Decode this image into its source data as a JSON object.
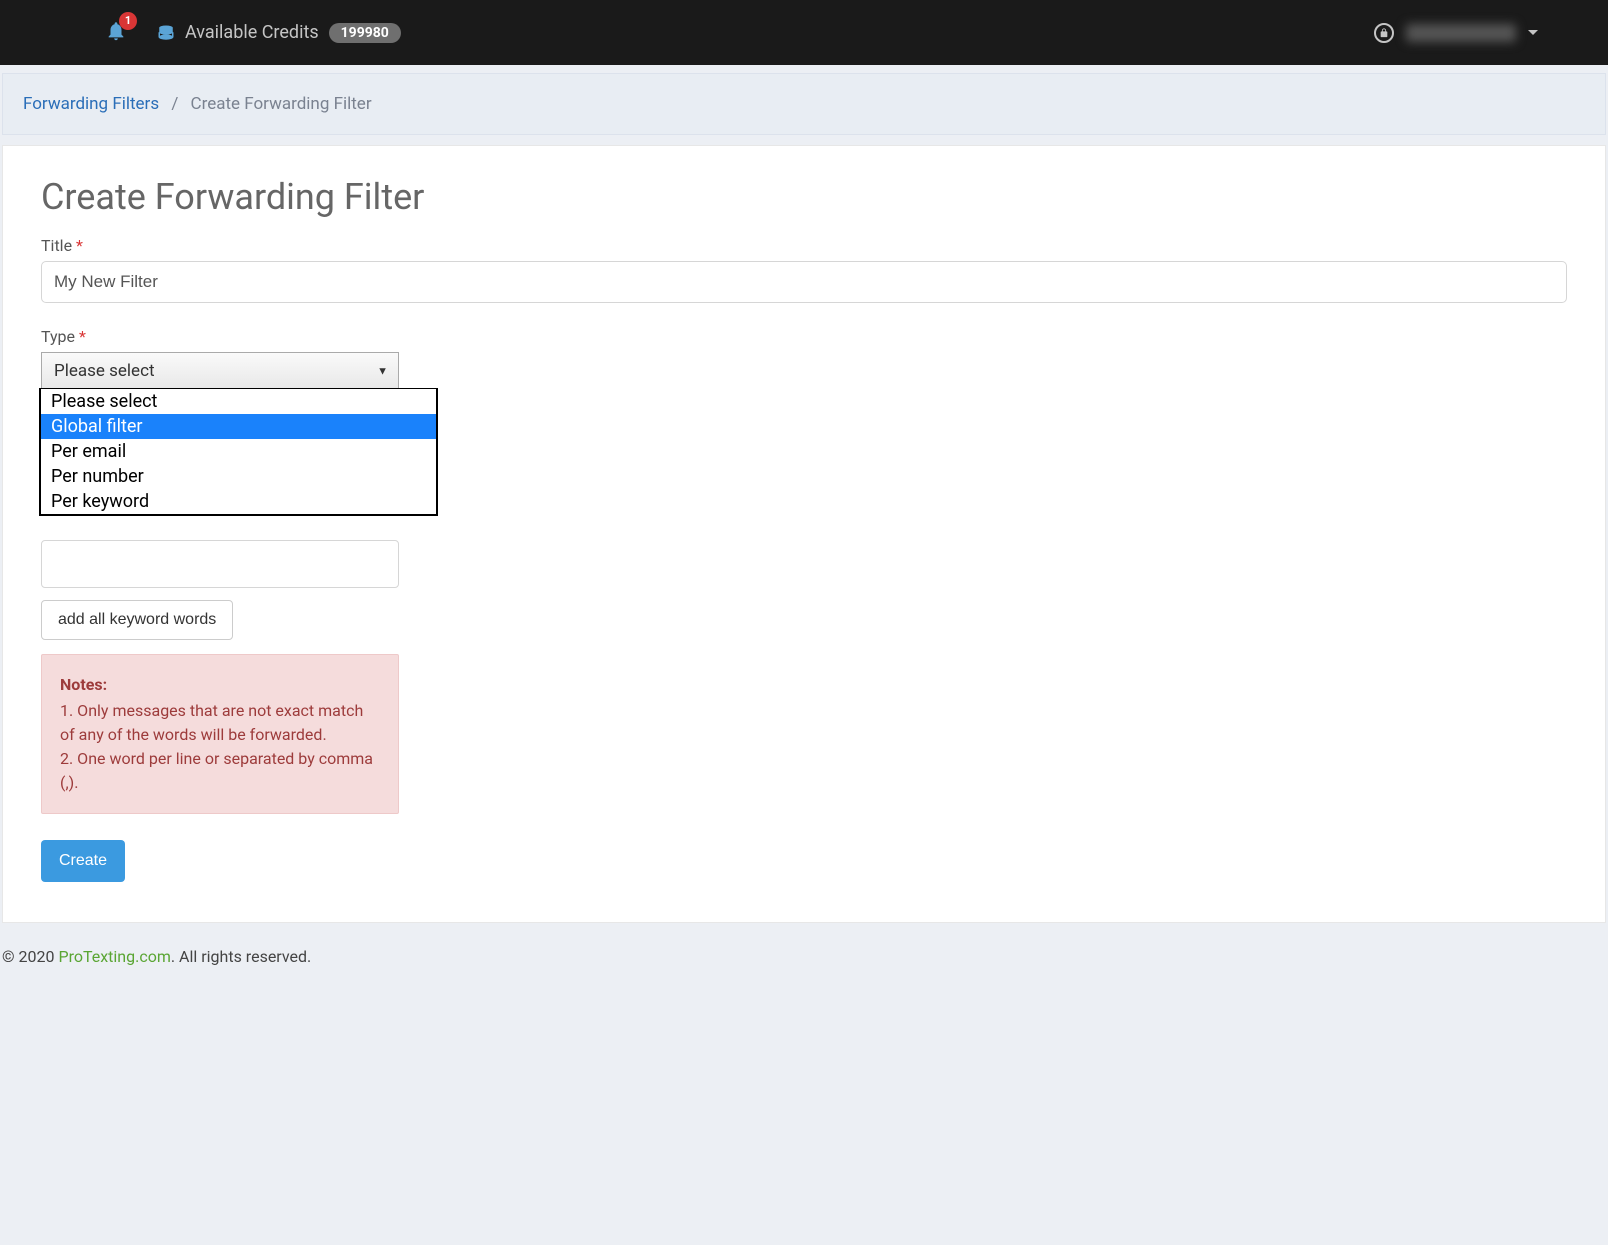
{
  "header": {
    "notification_count": "1",
    "credits_label": "Available Credits",
    "credits_value": "199980"
  },
  "breadcrumb": {
    "parent": "Forwarding Filters",
    "current": "Create Forwarding Filter"
  },
  "page": {
    "title": "Create Forwarding Filter"
  },
  "form": {
    "title_label": "Title",
    "title_value": "My New Filter",
    "type_label": "Type",
    "type_selected": "Please select",
    "type_options": [
      "Please select",
      "Global filter",
      "Per email",
      "Per number",
      "Per keyword"
    ],
    "type_highlighted_index": 1,
    "add_keywords_label": "add all keyword words",
    "notes_title": "Notes:",
    "note_1": "1. Only messages that are not exact match of any of the words will be forwarded.",
    "note_2": "2. One word per line or separated by comma (,).",
    "submit_label": "Create"
  },
  "footer": {
    "copyright_prefix": "© 2020 ",
    "brand": "ProTexting.com",
    "copyright_suffix": ". All rights reserved."
  }
}
